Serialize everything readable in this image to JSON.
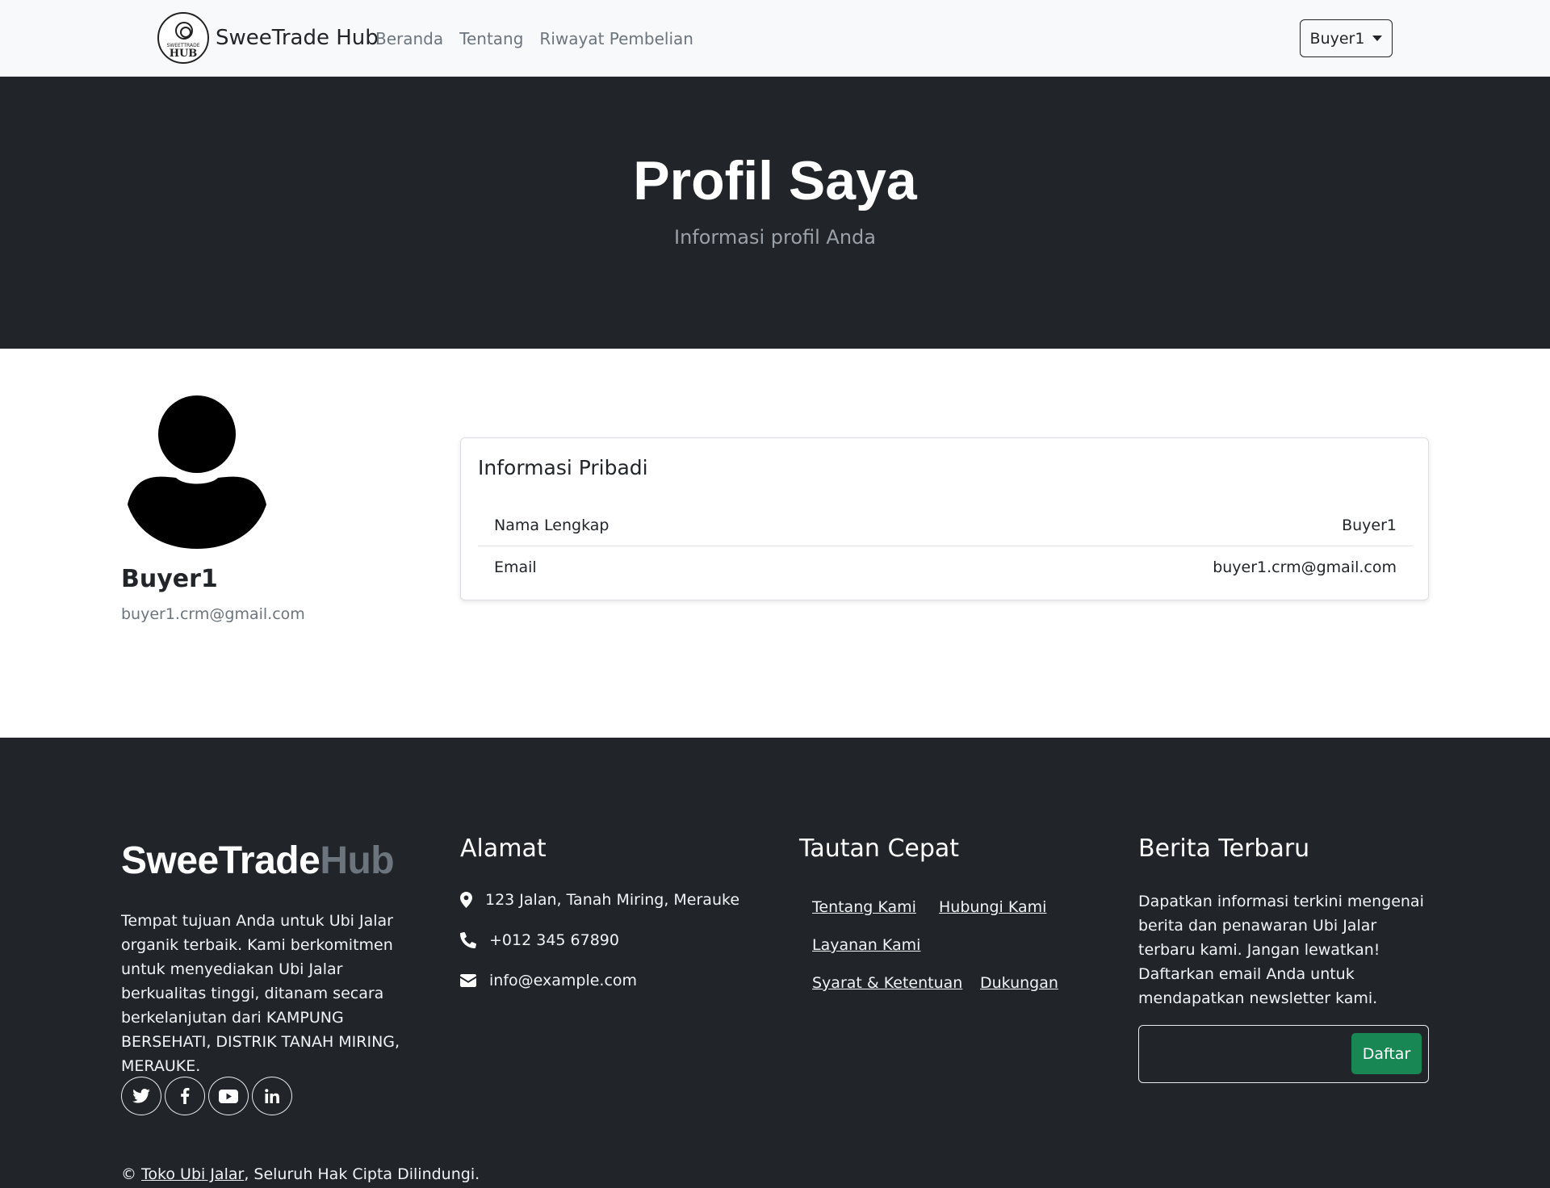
{
  "navbar": {
    "logo_small": "SWEETTRADE",
    "logo_big": "HUB",
    "brand": "SweeTrade Hub",
    "links": [
      "Beranda",
      "Tentang",
      "Riwayat Pembelian"
    ],
    "user_dropdown": "Buyer1"
  },
  "hero": {
    "title": "Profil Saya",
    "subtitle": "Informasi profil Anda"
  },
  "profile": {
    "name": "Buyer1",
    "email": "buyer1.crm@gmail.com",
    "card_title": "Informasi Pribadi",
    "rows": [
      {
        "label": "Nama Lengkap",
        "value": "Buyer1"
      },
      {
        "label": "Email",
        "value": "buyer1.crm@gmail.com"
      }
    ]
  },
  "footer": {
    "logo_part1": "SweeTrade",
    "logo_part2": "Hub",
    "description": "Tempat tujuan Anda untuk Ubi Jalar organik terbaik. Kami berkomitmen untuk menyediakan Ubi Jalar berkualitas tinggi, ditanam secara berkelanjutan dari KAMPUNG BERSEHATI, DISTRIK TANAH MIRING, MERAUKE.",
    "address_title": "Alamat",
    "address": "123 Jalan, Tanah Miring, Merauke",
    "phone": "+012 345 67890",
    "email": "info@example.com",
    "links_title": "Tautan Cepat",
    "links": [
      "Tentang Kami",
      "Hubungi Kami",
      "Layanan Kami",
      "Syarat & Ketentuan",
      "Dukungan"
    ],
    "news_title": "Berita Terbaru",
    "news_desc": "Dapatkan informasi terkini mengenai berita dan penawaran Ubi Jalar terbaru kami. Jangan lewatkan! Daftarkan email Anda untuk mendapatkan newsletter kami.",
    "news_placeholder": "",
    "news_button": "Daftar",
    "copyright_symbol": "©",
    "copyright_link": "Toko Ubi Jalar",
    "copyright_rest": ", Seluruh Hak Cipta Dilindungi.",
    "socials": [
      "twitter-icon",
      "facebook-icon",
      "youtube-icon",
      "linkedin-icon"
    ]
  }
}
